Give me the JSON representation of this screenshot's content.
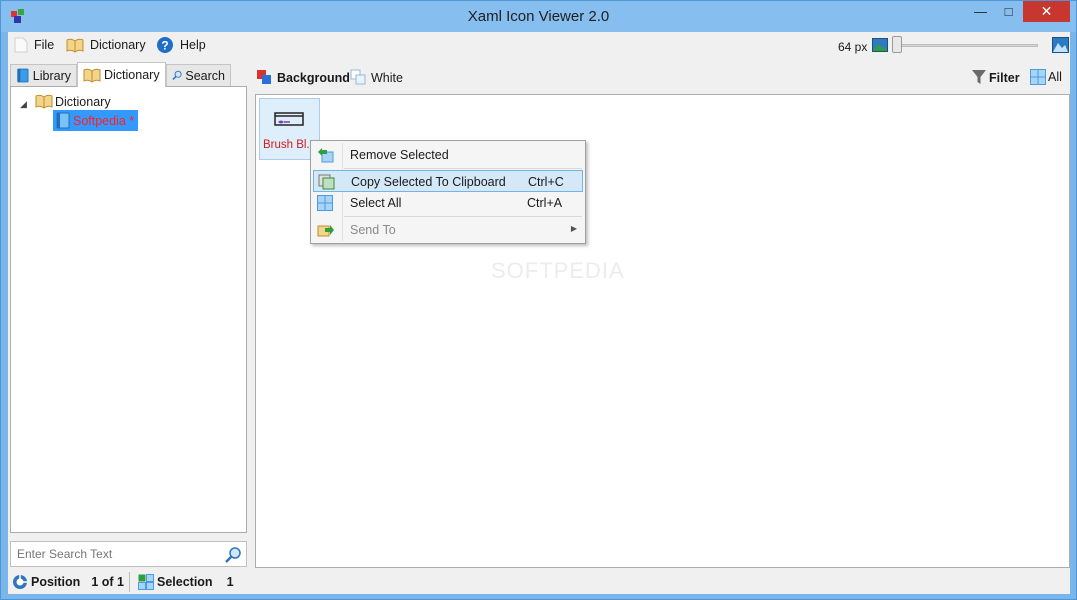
{
  "window": {
    "title": "Xaml Icon Viewer 2.0"
  },
  "menu": {
    "file": "File",
    "dictionary": "Dictionary",
    "help": "Help"
  },
  "zoom": {
    "label": "64 px",
    "slider_level": 0.0
  },
  "tabs": [
    {
      "label": "Library"
    },
    {
      "label": "Dictionary"
    },
    {
      "label": "Search"
    }
  ],
  "tree": {
    "root": "Dictionary",
    "child": "Softpedia *"
  },
  "search": {
    "placeholder": "Enter Search Text"
  },
  "toolbar": {
    "background_label": "Background",
    "white_label": "White",
    "filter_label": "Filter",
    "all_label": "All"
  },
  "icons": [
    {
      "label": "Brush Bl..."
    }
  ],
  "watermark": "SOFTPEDIA",
  "context_menu": {
    "remove": "Remove Selected",
    "copy": "Copy Selected To Clipboard",
    "copy_shortcut": "Ctrl+C",
    "select_all": "Select All",
    "select_all_shortcut": "Ctrl+A",
    "send_to": "Send To"
  },
  "status": {
    "position_label": "Position",
    "position_value": "1 of 1",
    "selection_label": "Selection",
    "selection_value": "1"
  },
  "colors": {
    "title_bar": "#86bef0",
    "close_button": "#c7372f",
    "selection": "#3399ff",
    "modified_text": "#ff2020",
    "tile_label": "#d11c1c"
  }
}
